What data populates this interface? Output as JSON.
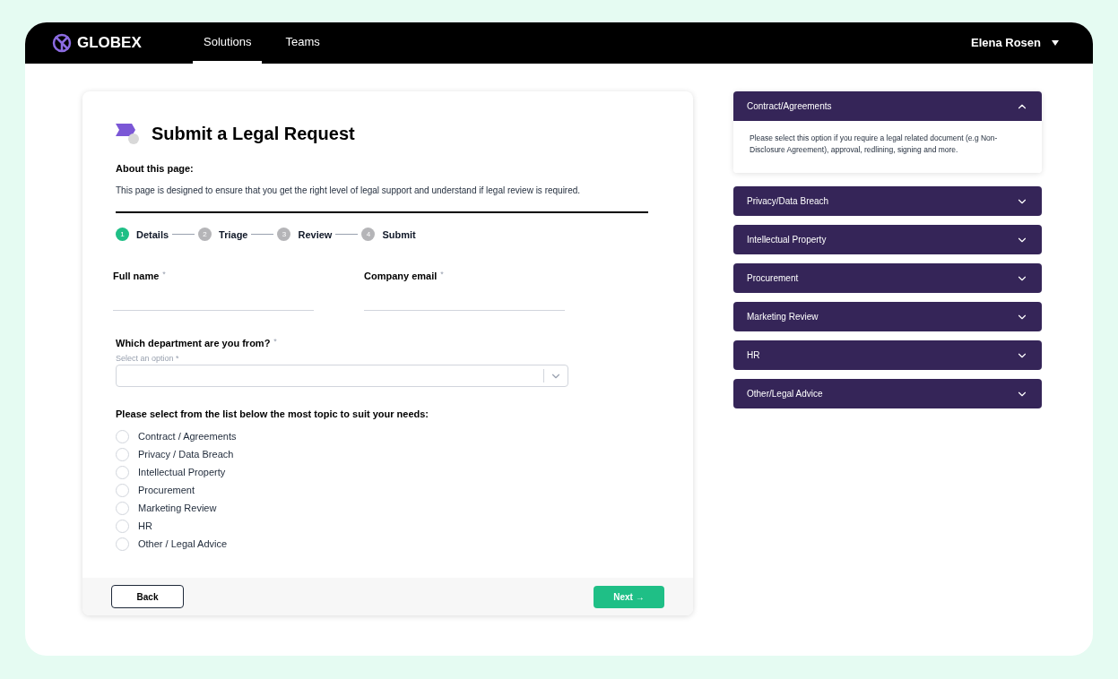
{
  "brand": "GLOBEX",
  "nav": [
    {
      "label": "Solutions",
      "selected": true
    },
    {
      "label": "Teams",
      "selected": false
    }
  ],
  "user": "Elena Rosen",
  "form": {
    "title": "Submit a Legal Request",
    "about_heading": "About this page:",
    "about_text": "This page is designed to ensure that you get the right level of legal support and understand if legal review is required.",
    "steps": [
      {
        "number": "1",
        "label": "Details",
        "selected": true
      },
      {
        "number": "2",
        "label": "Triage",
        "selected": false
      },
      {
        "number": "3",
        "label": "Review",
        "selected": false
      },
      {
        "number": "4",
        "label": "Submit",
        "selected": false
      }
    ],
    "full_name": {
      "label": "Full name",
      "required": "*"
    },
    "company_email": {
      "label": "Company email",
      "required": "*"
    },
    "department": {
      "label": "Which department are you from?",
      "required": "*",
      "placeholder": "Select an option *"
    },
    "topic_question": "Please select from the list below the most topic to suit your needs:",
    "topics": [
      {
        "label": "Contract / Agreements",
        "selected": false
      },
      {
        "label": "Privacy / Data Breach",
        "selected": false
      },
      {
        "label": "Intellectual Property",
        "selected": false
      },
      {
        "label": "Procurement",
        "selected": false
      },
      {
        "label": "Marketing Review",
        "selected": false
      },
      {
        "label": "HR",
        "selected": false
      },
      {
        "label": "Other / Legal Advice",
        "selected": false
      }
    ],
    "back_button": "Back",
    "next_button": "Next →"
  },
  "accordion": [
    {
      "title": "Contract/Agreements",
      "expanded": true,
      "body": "Please select this option if you require a legal related document (e.g Non-Disclosure Agreement), approval, redlining, signing and more."
    },
    {
      "title": "Privacy/Data Breach",
      "expanded": false
    },
    {
      "title": "Intellectual Property",
      "expanded": false
    },
    {
      "title": "Procurement",
      "expanded": false
    },
    {
      "title": "Marketing Review",
      "expanded": false
    },
    {
      "title": "HR",
      "expanded": false
    },
    {
      "title": "Other/Legal Advice",
      "expanded": false
    }
  ]
}
